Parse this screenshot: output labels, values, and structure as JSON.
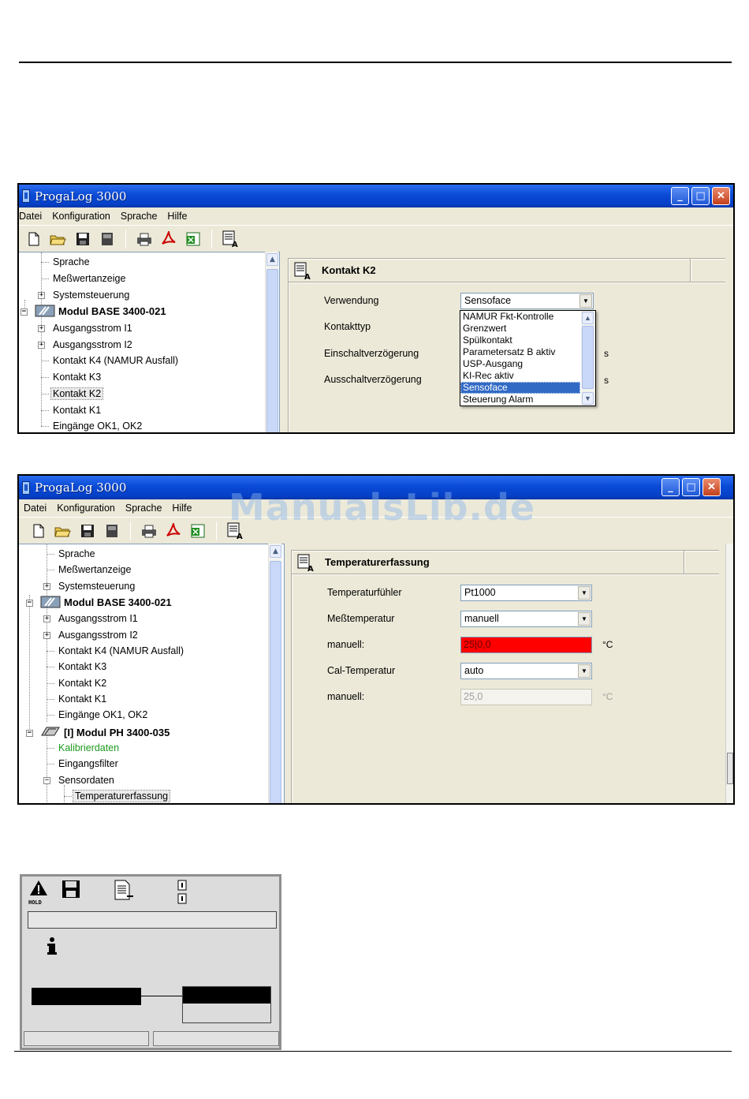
{
  "window1": {
    "title": "ProgaLog 3000",
    "menu": [
      "Datei",
      "Konfiguration",
      "Sprache",
      "Hilfe"
    ],
    "tree": [
      {
        "label": "Sprache"
      },
      {
        "label": "Meßwertanzeige"
      },
      {
        "label": "Systemsteuerung"
      },
      {
        "label": "Modul BASE 3400-021"
      },
      {
        "label": "Ausgangsstrom I1"
      },
      {
        "label": "Ausgangsstrom I2"
      },
      {
        "label": "Kontakt K4  (NAMUR Ausfall)"
      },
      {
        "label": "Kontakt K3"
      },
      {
        "label": "Kontakt K2"
      },
      {
        "label": "Kontakt K1"
      },
      {
        "label": "Eingänge OK1, OK2"
      }
    ],
    "panel": {
      "title": "Kontakt K2",
      "fields": {
        "verwendung_label": "Verwendung",
        "verwendung_value": "Sensoface",
        "kontakttyp_label": "Kontakttyp",
        "einschalt_label": "Einschaltverzögerung",
        "einschalt_unit": "s",
        "ausschalt_label": "Ausschaltverzögerung",
        "ausschalt_unit": "s"
      },
      "dropdown_options": [
        "NAMUR Fkt-Kontrolle",
        "Grenzwert",
        "Spülkontakt",
        "Parametersatz B aktiv",
        "USP-Ausgang",
        "KI-Rec aktiv",
        "Sensoface",
        "Steuerung Alarm"
      ],
      "dropdown_selected": "Sensoface"
    }
  },
  "window2": {
    "title": "ProgaLog 3000",
    "menu": [
      "Datei",
      "Konfiguration",
      "Sprache",
      "Hilfe"
    ],
    "tree": [
      {
        "label": "Sprache"
      },
      {
        "label": "Meßwertanzeige"
      },
      {
        "label": "Systemsteuerung"
      },
      {
        "label": "Modul BASE 3400-021"
      },
      {
        "label": "Ausgangsstrom I1"
      },
      {
        "label": "Ausgangsstrom I2"
      },
      {
        "label": "Kontakt K4  (NAMUR Ausfall)"
      },
      {
        "label": "Kontakt K3"
      },
      {
        "label": "Kontakt K2"
      },
      {
        "label": "Kontakt K1"
      },
      {
        "label": "Eingänge OK1, OK2"
      },
      {
        "label": "[I] Modul PH 3400-035"
      },
      {
        "label": "Kalibrierdaten"
      },
      {
        "label": "Eingangsfilter"
      },
      {
        "label": "Sensordaten"
      },
      {
        "label": "Temperaturerfassung"
      }
    ],
    "panel": {
      "title": "Temperaturerfassung",
      "fields": {
        "fuehler_label": "Temperaturfühler",
        "fuehler_value": "Pt1000",
        "messtemp_label": "Meßtemperatur",
        "messtemp_value": "manuell",
        "manuell1_label": "manuell:",
        "manuell1_value": "25|0,0",
        "manuell1_unit": "°C",
        "caltemp_label": "Cal-Temperatur",
        "caltemp_value": "auto",
        "manuell2_label": "manuell:",
        "manuell2_value": "25,0",
        "manuell2_unit": "°C"
      }
    }
  },
  "watermark": "ManualsLib.de",
  "device_display": {
    "hold_label": "HOLD"
  },
  "colors": {
    "titlebar": "#0a4ad6",
    "selection": "#316ac5",
    "error_field": "#ff0000",
    "green_item": "#1e9a1e"
  }
}
